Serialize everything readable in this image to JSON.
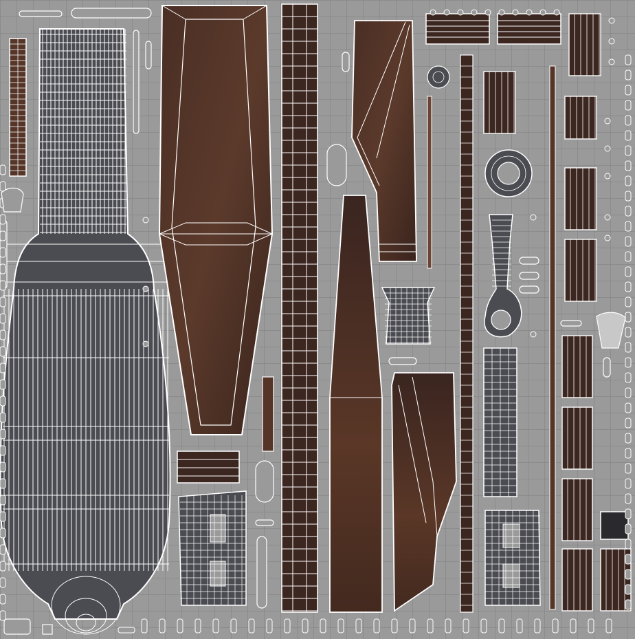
{
  "colors": {
    "background": "#9a9a9a",
    "grid": "#7f7f7f",
    "wire": "#ffffff",
    "mesh_fill": "#4b4b52",
    "wood_dark": "#3c2620",
    "wood_mid": "#553528",
    "wood_light": "#6a4434",
    "dark_square": "#2a2a2e"
  },
  "texture": {
    "style": "uv-wireframe-layout",
    "material": "weathered-wood",
    "grid": true
  }
}
